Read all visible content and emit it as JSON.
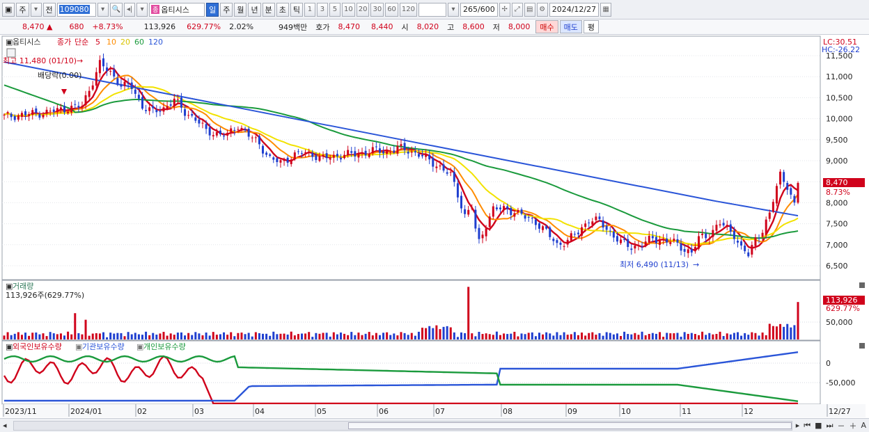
{
  "toolbar": {
    "market_label": "주",
    "prev_label": "전",
    "stock_code": "109080",
    "stock_tag": "종",
    "stock_name": "옵티시스",
    "period_buttons": [
      "일",
      "주",
      "월",
      "년",
      "분",
      "초",
      "틱"
    ],
    "interval_buttons": [
      "1",
      "3",
      "5",
      "10",
      "20",
      "30",
      "60",
      "120"
    ],
    "count_value": "265",
    "count_max": "/600",
    "date_value": "2024/12/27"
  },
  "quote": {
    "price": "8,470",
    "change_arrow": "▲",
    "change": "680",
    "change_pct": "+8.73%",
    "volume": "113,926",
    "volume_pct": "629.77%",
    "turnover_pct": "2.02%",
    "amount": "949백만",
    "ask_label": "호가",
    "ask": "8,470",
    "bid": "8,440",
    "open_label": "시",
    "open": "8,020",
    "high_label": "고",
    "high": "8,600",
    "low_label": "저",
    "low": "8,000",
    "buy_label": "매수",
    "sell_label": "매도",
    "eval_label": "평"
  },
  "chart_data": [
    {
      "type": "candlestick",
      "legend": {
        "name": "옵티시스",
        "close_label": "종가",
        "ma_type": "단순",
        "ma_periods": [
          "5",
          "10",
          "20",
          "60",
          "120"
        ],
        "ma_colors": [
          "#d0021b",
          "#ff8c00",
          "#f2e200",
          "#1a9a3c",
          "#2a55d8"
        ]
      },
      "x": [
        "2023/11",
        "2024/01",
        "02",
        "03",
        "04",
        "05",
        "06",
        "07",
        "08",
        "09",
        "10",
        "11",
        "12",
        "12/27"
      ],
      "y_ticks": [
        "11,500",
        "11,000",
        "10,500",
        "10,000",
        "9,500",
        "9,000",
        "8,500",
        "8,000",
        "7,500",
        "7,000",
        "6,500"
      ],
      "ylim": [
        6300,
        11700
      ],
      "lc": "LC:30.51",
      "hc": "HC:-26.22",
      "last_price_label": "8,470",
      "last_change_label": "8.73%",
      "annotations": {
        "high": "최고 11,480 (01/10)",
        "ex_dividend": "배당락(0.00)",
        "low": "최저 6,490 (11/13)"
      },
      "colors": {
        "up": "#d0021b",
        "down": "#1f3fcf"
      },
      "anchors": [
        [
          0,
          10050
        ],
        [
          6,
          10100
        ],
        [
          12,
          10150
        ],
        [
          18,
          10250
        ],
        [
          22,
          10300
        ],
        [
          24,
          10700
        ],
        [
          27,
          11300
        ],
        [
          30,
          11100
        ],
        [
          33,
          10800
        ],
        [
          36,
          10750
        ],
        [
          39,
          10300
        ],
        [
          42,
          10150
        ],
        [
          45,
          10250
        ],
        [
          48,
          10450
        ],
        [
          51,
          10150
        ],
        [
          54,
          10000
        ],
        [
          57,
          9700
        ],
        [
          60,
          9650
        ],
        [
          63,
          9600
        ],
        [
          66,
          9850
        ],
        [
          69,
          9600
        ],
        [
          72,
          9400
        ],
        [
          75,
          9050
        ],
        [
          78,
          8950
        ],
        [
          81,
          9100
        ],
        [
          84,
          9200
        ],
        [
          87,
          9150
        ],
        [
          90,
          9050
        ],
        [
          93,
          9100
        ],
        [
          96,
          9150
        ],
        [
          99,
          9150
        ],
        [
          102,
          9200
        ],
        [
          105,
          9250
        ],
        [
          108,
          9200
        ],
        [
          111,
          9300
        ],
        [
          114,
          9250
        ],
        [
          117,
          9150
        ],
        [
          120,
          9000
        ],
        [
          123,
          8850
        ],
        [
          126,
          8650
        ],
        [
          128,
          8200
        ],
        [
          130,
          7700
        ],
        [
          132,
          7900
        ],
        [
          133,
          7350
        ],
        [
          134,
          7050
        ],
        [
          136,
          7500
        ],
        [
          138,
          7850
        ],
        [
          141,
          7850
        ],
        [
          144,
          7800
        ],
        [
          147,
          7650
        ],
        [
          150,
          7550
        ],
        [
          153,
          7300
        ],
        [
          156,
          7000
        ],
        [
          159,
          7100
        ],
        [
          162,
          7300
        ],
        [
          165,
          7600
        ],
        [
          168,
          7550
        ],
        [
          171,
          7300
        ],
        [
          174,
          7050
        ],
        [
          177,
          6950
        ],
        [
          180,
          7000
        ],
        [
          183,
          7150
        ],
        [
          186,
          7100
        ],
        [
          189,
          7050
        ],
        [
          192,
          6900
        ],
        [
          194,
          6800
        ],
        [
          196,
          7150
        ],
        [
          199,
          7250
        ],
        [
          202,
          7500
        ],
        [
          204,
          7400
        ],
        [
          206,
          7250
        ],
        [
          208,
          6900
        ],
        [
          210,
          6750
        ],
        [
          212,
          7150
        ],
        [
          214,
          7350
        ],
        [
          216,
          7700
        ],
        [
          218,
          8400
        ],
        [
          219,
          8700
        ],
        [
          221,
          8400
        ],
        [
          223,
          7900
        ],
        [
          224,
          8470
        ]
      ]
    },
    {
      "type": "bar",
      "title": "거래량",
      "summary": "113,926주(629.77%)",
      "y_ticks": [
        "50,000"
      ],
      "ylim": [
        0,
        165000
      ],
      "last_volume_label": "113,926",
      "last_volume_pct_label": "629.77%"
    },
    {
      "type": "line",
      "series": [
        {
          "name": "외국인보유수량",
          "color": "#d0021b"
        },
        {
          "name": "기관보유수량",
          "color": "#2a55d8"
        },
        {
          "name": "개인보유수량",
          "color": "#1a9a3c"
        }
      ],
      "y_ticks": [
        "0",
        "-50,000"
      ]
    }
  ],
  "bottom": {
    "icons": [
      "scroll-left-icon",
      "scroll-right-icon",
      "first-icon",
      "stop-icon",
      "last-icon",
      "zoom-out-icon",
      "zoom-in-icon",
      "settings-icon"
    ]
  }
}
